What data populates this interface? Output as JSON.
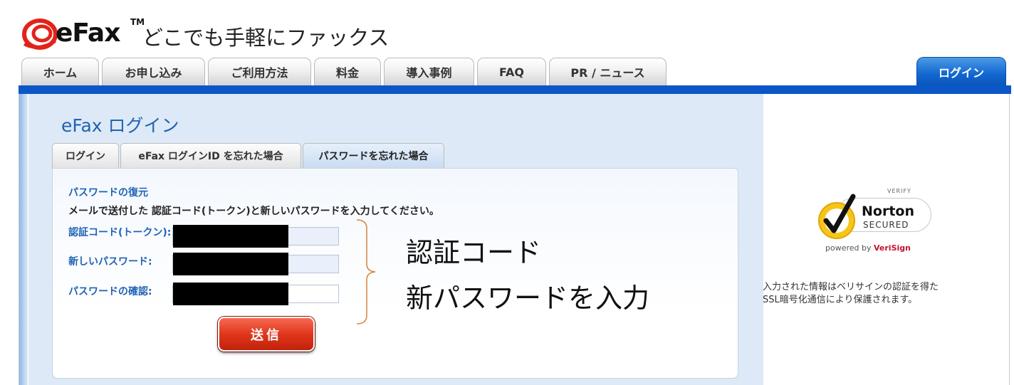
{
  "logo": {
    "brand": "eFax",
    "tm": "TM",
    "tagline": "どこでも手軽にファックス"
  },
  "nav": {
    "tabs": [
      {
        "label": "ホーム"
      },
      {
        "label": "お申し込み"
      },
      {
        "label": "ご利用方法"
      },
      {
        "label": "料金"
      },
      {
        "label": "導入事例"
      },
      {
        "label": "FAQ"
      },
      {
        "label": "PR / ニュース"
      }
    ],
    "login_label": "ログイン"
  },
  "page": {
    "title": "eFax ログイン"
  },
  "subtabs": [
    {
      "label": "ログイン"
    },
    {
      "label": "eFax ログインID を忘れた場合"
    },
    {
      "label": "パスワードを忘れた場合",
      "active": true
    }
  ],
  "form": {
    "section_title": "パスワードの復元",
    "instruction": "メールで送付した 認証コード(トークン)と新しいパスワードを入力してください。",
    "fields": [
      {
        "label": "認証コード(トークン):",
        "value": ""
      },
      {
        "label": "新しいパスワード:",
        "value": ""
      },
      {
        "label": "パスワードの確認:",
        "value": ""
      }
    ],
    "submit_label": "送信"
  },
  "annotation": {
    "line1": "認証コード",
    "line2": "新パスワードを入力"
  },
  "norton": {
    "verify": "VERIFY",
    "name": "Norton",
    "secured": "SECURED",
    "powered_prefix": "powered by ",
    "powered_brand": "VeriSign"
  },
  "ssl_note": {
    "line1": "入力された情報はベリサインの認証を得た",
    "line2": "SSL暗号化通信により保護されます。"
  },
  "colors": {
    "accent_blue": "#0b57c8",
    "link_blue": "#1f63b5",
    "submit_red": "#e0371c",
    "logo_red": "#e2231a"
  },
  "icons": {
    "logo": "efax-logo-icon",
    "check": "norton-check-icon"
  }
}
